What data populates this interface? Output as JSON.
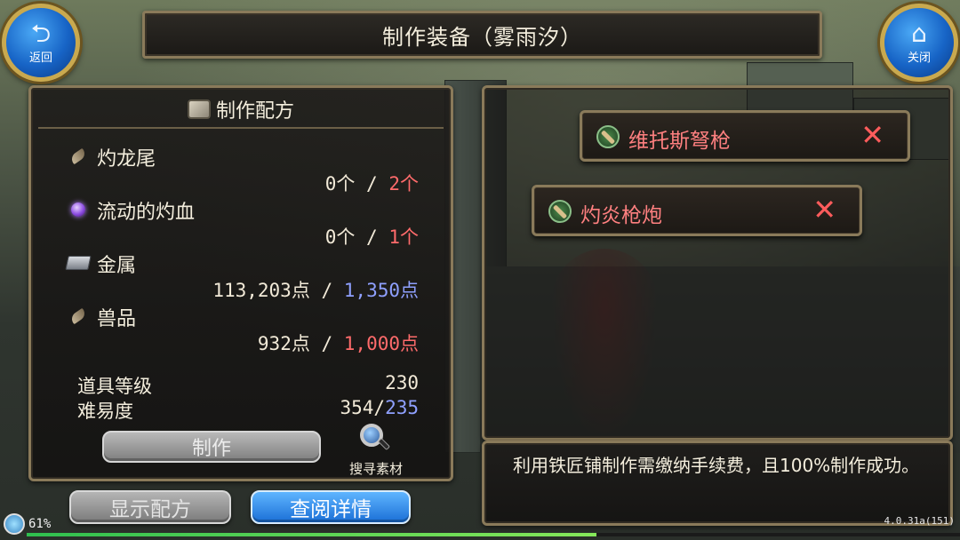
{
  "title": "制作装备（雾雨汐）",
  "nav": {
    "back_label": "返回",
    "close_label": "关闭",
    "back_icon": "return-arrow-icon",
    "close_icon": "home-icon"
  },
  "recipe": {
    "header": "制作配方",
    "materials": [
      {
        "name": "灼龙尾",
        "icon": "feather-icon",
        "have": "0个",
        "sep": " / ",
        "need": "2个",
        "need_color": "#ff6b6b"
      },
      {
        "name": "流动的灼血",
        "icon": "purple-orb-icon",
        "have": "0个",
        "sep": " / ",
        "need": "1个",
        "need_color": "#ff6b6b"
      },
      {
        "name": "金属",
        "icon": "metal-ingot-icon",
        "have": "113,203点",
        "sep": " / ",
        "need": "1,350点",
        "need_color": "#8fa0ff"
      },
      {
        "name": "兽品",
        "icon": "feather-icon",
        "have": "932点",
        "sep": " / ",
        "need": "1,000点",
        "need_color": "#ff6b6b"
      }
    ],
    "item_level_label": "道具等级",
    "item_level_value": "230",
    "difficulty_label": "难易度",
    "difficulty_current": "354",
    "difficulty_sep": "/",
    "difficulty_target": "235",
    "make_label": "制作",
    "search_label": "搜寻素材"
  },
  "buttons": {
    "show_recipe": "显示配方",
    "view_detail": "查阅详情"
  },
  "items": [
    {
      "name": "维托斯弩枪",
      "remove": "✕"
    },
    {
      "name": "灼炎枪炮",
      "remove": "✕"
    }
  ],
  "message": "利用铁匠铺制作需缴纳手续费，且100%制作成功。",
  "status": {
    "battery": "61%",
    "battery_level": 0.61,
    "version": "4.0.31a(151)"
  },
  "colors": {
    "frame_gold": "#8a7a5a",
    "blue_button": "#1a6fd6",
    "red_text": "#ff6b6b",
    "blue_text": "#8fa0ff"
  }
}
